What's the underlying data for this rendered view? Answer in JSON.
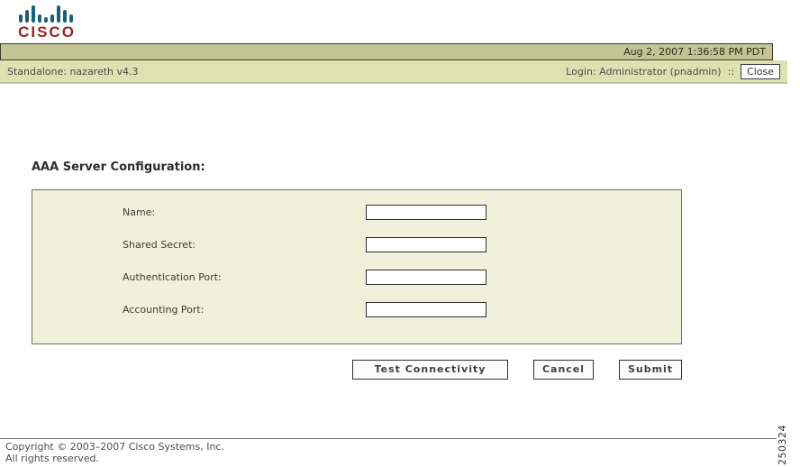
{
  "header": {
    "brand": "CISCO",
    "datetime": "Aug 2, 2007 1:36:58 PM PDT",
    "standalone": "Standalone: nazareth v4.3",
    "login": "Login: Administrator (pnadmin)",
    "separator": "::",
    "close_label": "Close"
  },
  "main": {
    "title": "AAA Server Configuration:",
    "fields": [
      {
        "label": "Name:",
        "value": ""
      },
      {
        "label": "Shared Secret:",
        "value": ""
      },
      {
        "label": "Authentication Port:",
        "value": ""
      },
      {
        "label": "Accounting Port:",
        "value": ""
      }
    ],
    "buttons": {
      "test": "Test Connectivity",
      "cancel": "Cancel",
      "submit": "Submit"
    }
  },
  "footer": {
    "copyright_line1": "Copyright © 2003–2007 Cisco Systems, Inc.",
    "copyright_line2": "All rights reserved.",
    "figure_number": "250324"
  },
  "colors": {
    "logo_bars": "#19607c",
    "logo_text": "#9d2226",
    "datebar_bg": "#c3c496",
    "loginbar_bg": "#dee1b2",
    "panel_bg": "#f0f1da",
    "panel_border": "#72724e"
  }
}
